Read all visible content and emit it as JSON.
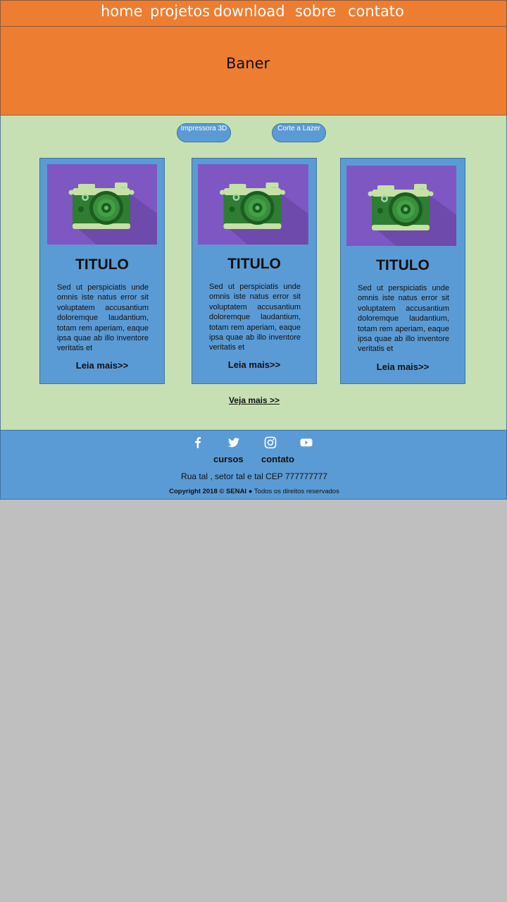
{
  "nav": {
    "items": [
      "home",
      "projetos",
      "download",
      "sobre",
      "contato"
    ]
  },
  "banner": {
    "title": "Baner"
  },
  "filters": [
    "Impressora 3D",
    "Corte a Lazer"
  ],
  "cards": [
    {
      "title": "TITULO",
      "text": "Sed ut perspiciatis unde omnis iste natus error sit voluptatem accusantium doloremque laudantium, totam rem aperiam, eaque ipsa quae ab illo inventore veritatis et",
      "link": "Leia mais>>",
      "image": "camera-icon"
    },
    {
      "title": "TITULO",
      "text": "Sed ut perspiciatis unde omnis iste natus error sit voluptatem accusantium doloremque laudantium, totam rem aperiam, eaque ipsa quae ab illo inventore veritatis et",
      "link": "Leia mais>>",
      "image": "camera-icon"
    },
    {
      "title": "TITULO",
      "text": "Sed ut perspiciatis unde omnis iste natus error sit voluptatem accusantium doloremque laudantium, totam rem aperiam, eaque ipsa quae ab illo inventore veritatis et",
      "link": "Leia mais>>",
      "image": "camera-icon"
    }
  ],
  "more_link": "Veja mais >>",
  "footer": {
    "social": [
      "facebook-icon",
      "twitter-icon",
      "instagram-icon",
      "youtube-icon"
    ],
    "links": [
      "cursos",
      "contato"
    ],
    "address": "Rua tal , setor tal e tal CEP 777777777",
    "copyright_bold": "Copyright 2018 © SENAI",
    "copyright_rest": "● Todos os direitos reservados"
  },
  "colors": {
    "orange": "#ed7d31",
    "green_bg": "#c6e0b4",
    "blue": "#5b9bd5",
    "purple": "#7e57c2",
    "page_bg": "#bfbfbf"
  }
}
